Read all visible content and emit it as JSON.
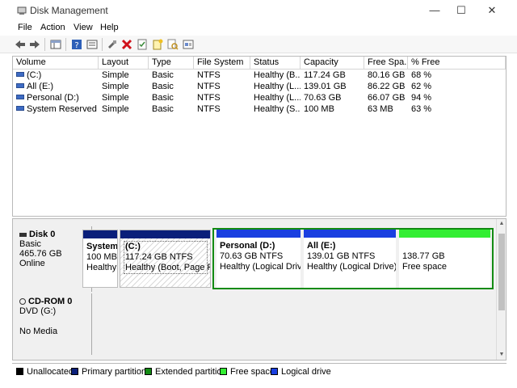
{
  "window": {
    "title": "Disk Management",
    "minimize": "—",
    "maximize": "☐",
    "close": "✕"
  },
  "menu": [
    "File",
    "Action",
    "View",
    "Help"
  ],
  "columns": [
    "Volume",
    "Layout",
    "Type",
    "File System",
    "Status",
    "Capacity",
    "Free Spa...",
    "% Free"
  ],
  "volumes": [
    [
      "(C:)",
      "Simple",
      "Basic",
      "NTFS",
      "Healthy (B...",
      "117.24 GB",
      "80.16 GB",
      "68 %"
    ],
    [
      "All (E:)",
      "Simple",
      "Basic",
      "NTFS",
      "Healthy (L...",
      "139.01 GB",
      "86.22 GB",
      "62 %"
    ],
    [
      "Personal (D:)",
      "Simple",
      "Basic",
      "NTFS",
      "Healthy (L...",
      "70.63 GB",
      "66.07 GB",
      "94 %"
    ],
    [
      "System Reserved",
      "Simple",
      "Basic",
      "NTFS",
      "Healthy (S...",
      "100 MB",
      "63 MB",
      "63 %"
    ]
  ],
  "disk0": {
    "name": "Disk 0",
    "type": "Basic",
    "size": "465.76 GB",
    "status": "Online",
    "partitions": [
      {
        "name": "System",
        "line2": "100 MB",
        "line3": "Healthy"
      },
      {
        "name": "(C:)",
        "line2": "117.24 GB NTFS",
        "line3": "Healthy (Boot, Page File"
      },
      {
        "name": "Personal  (D:)",
        "line2": "70.63 GB NTFS",
        "line3": "Healthy (Logical Drive"
      },
      {
        "name": "All  (E:)",
        "line2": "139.01 GB NTFS",
        "line3": "Healthy (Logical Drive)"
      },
      {
        "name": "",
        "line2": "138.77 GB",
        "line3": "Free space"
      }
    ]
  },
  "cdrom0": {
    "name": "CD-ROM 0",
    "type": "DVD (G:)",
    "status": "No Media"
  },
  "legend": [
    "Unallocated",
    "Primary partition",
    "Extended partition",
    "Free space",
    "Logical drive"
  ],
  "colors": {
    "unallocated": "#000000",
    "primary": "#0a1f7a",
    "extended": "#138b13",
    "free": "#33ee33",
    "logical": "#1a3fe0"
  }
}
